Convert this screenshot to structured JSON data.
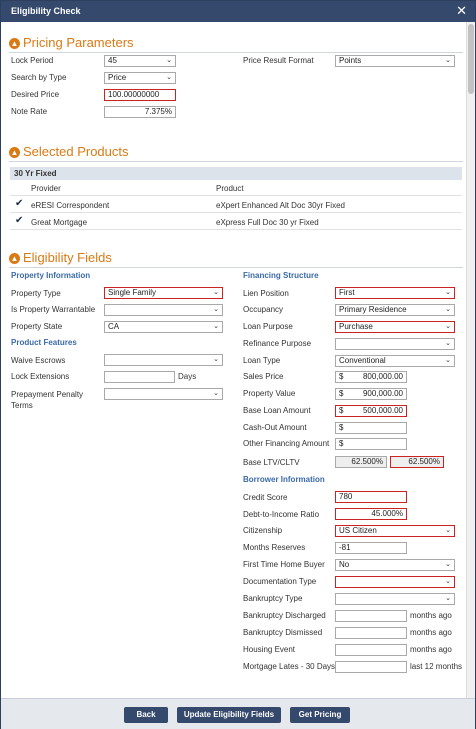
{
  "window": {
    "title": "Eligibility Check",
    "close": "✕"
  },
  "pricing": {
    "title": "Pricing Parameters",
    "lock_period": {
      "label": "Lock Period",
      "value": "45"
    },
    "search_by_type": {
      "label": "Search by Type",
      "value": "Price"
    },
    "desired_price": {
      "label": "Desired Price",
      "value": "100.00000000"
    },
    "note_rate": {
      "label": "Note Rate",
      "value": "7.375",
      "unit": "%"
    },
    "price_result_format": {
      "label": "Price Result Format",
      "value": "Points"
    }
  },
  "products": {
    "title": "Selected Products",
    "group": "30 Yr Fixed",
    "col_provider": "Provider",
    "col_product": "Product",
    "rows": [
      {
        "provider": "eRESI Correspondent",
        "product": "eXpert Enhanced Alt Doc 30yr Fixed"
      },
      {
        "provider": "Great Mortgage",
        "product": "eXpress Full Doc 30 yr Fixed"
      }
    ]
  },
  "eligibility": {
    "title": "Eligibility Fields",
    "property_info": {
      "heading": "Property Information",
      "property_type": {
        "label": "Property Type",
        "value": "Single Family"
      },
      "warrantable": {
        "label": "Is Property Warrantable",
        "value": ""
      },
      "state": {
        "label": "Property State",
        "value": "CA"
      }
    },
    "product_features": {
      "heading": "Product Features",
      "waive_escrows": {
        "label": "Waive Escrows",
        "value": ""
      },
      "lock_extensions": {
        "label": "Lock Extensions",
        "value": "",
        "unit": "Days"
      },
      "prepayment": {
        "label": "Prepayment Penalty Terms",
        "value": ""
      }
    },
    "financing": {
      "heading": "Financing Structure",
      "lien_position": {
        "label": "Lien Position",
        "value": "First"
      },
      "occupancy": {
        "label": "Occupancy",
        "value": "Primary Residence"
      },
      "loan_purpose": {
        "label": "Loan Purpose",
        "value": "Purchase"
      },
      "refinance_purpose": {
        "label": "Refinance Purpose",
        "value": ""
      },
      "loan_type": {
        "label": "Loan Type",
        "value": "Conventional"
      },
      "sales_price": {
        "label": "Sales Price",
        "value": "800,000.00"
      },
      "property_value": {
        "label": "Property Value",
        "value": "900,000.00"
      },
      "base_loan_amount": {
        "label": "Base Loan Amount",
        "value": "500,000.00"
      },
      "cash_out": {
        "label": "Cash-Out Amount",
        "value": ""
      },
      "other_financing": {
        "label": "Other Financing Amount",
        "value": ""
      },
      "ltv": {
        "label": "Base LTV/CLTV",
        "ltv": "62.500",
        "cltv": "62.500",
        "unit": "%"
      },
      "currency": "$"
    },
    "borrower": {
      "heading": "Borrower Information",
      "credit_score": {
        "label": "Credit Score",
        "value": "780"
      },
      "dti": {
        "label": "Debt-to-Income Ratio",
        "value": "45.000",
        "unit": "%"
      },
      "citizenship": {
        "label": "Citizenship",
        "value": "US Citizen"
      },
      "months_reserves": {
        "label": "Months Reserves",
        "value": "-81"
      },
      "first_time": {
        "label": "First Time Home Buyer",
        "value": "No"
      },
      "doc_type": {
        "label": "Documentation Type",
        "value": ""
      },
      "bankruptcy_type": {
        "label": "Bankruptcy Type",
        "value": ""
      },
      "bk_discharged": {
        "label": "Bankruptcy Discharged",
        "value": "",
        "unit": "months ago"
      },
      "bk_dismissed": {
        "label": "Bankruptcy Dismissed",
        "value": "",
        "unit": "months ago"
      },
      "housing_event": {
        "label": "Housing Event",
        "value": "",
        "unit": "months ago"
      },
      "mortgage_lates": {
        "label": "Mortgage Lates - 30 Days",
        "value": "",
        "unit": "last 12 months"
      }
    }
  },
  "footer": {
    "back": "Back",
    "update": "Update Eligibility Fields",
    "get_pricing": "Get Pricing"
  },
  "colors": {
    "accent": "#d97a14",
    "titlebar": "#34496b",
    "required": "#cc2222",
    "subheading": "#3a6aa8"
  },
  "icons": {
    "section_toggle": "chevron-up-icon",
    "dropdown": "chevron-down-icon",
    "check": "checkmark-icon",
    "close": "close-icon"
  }
}
